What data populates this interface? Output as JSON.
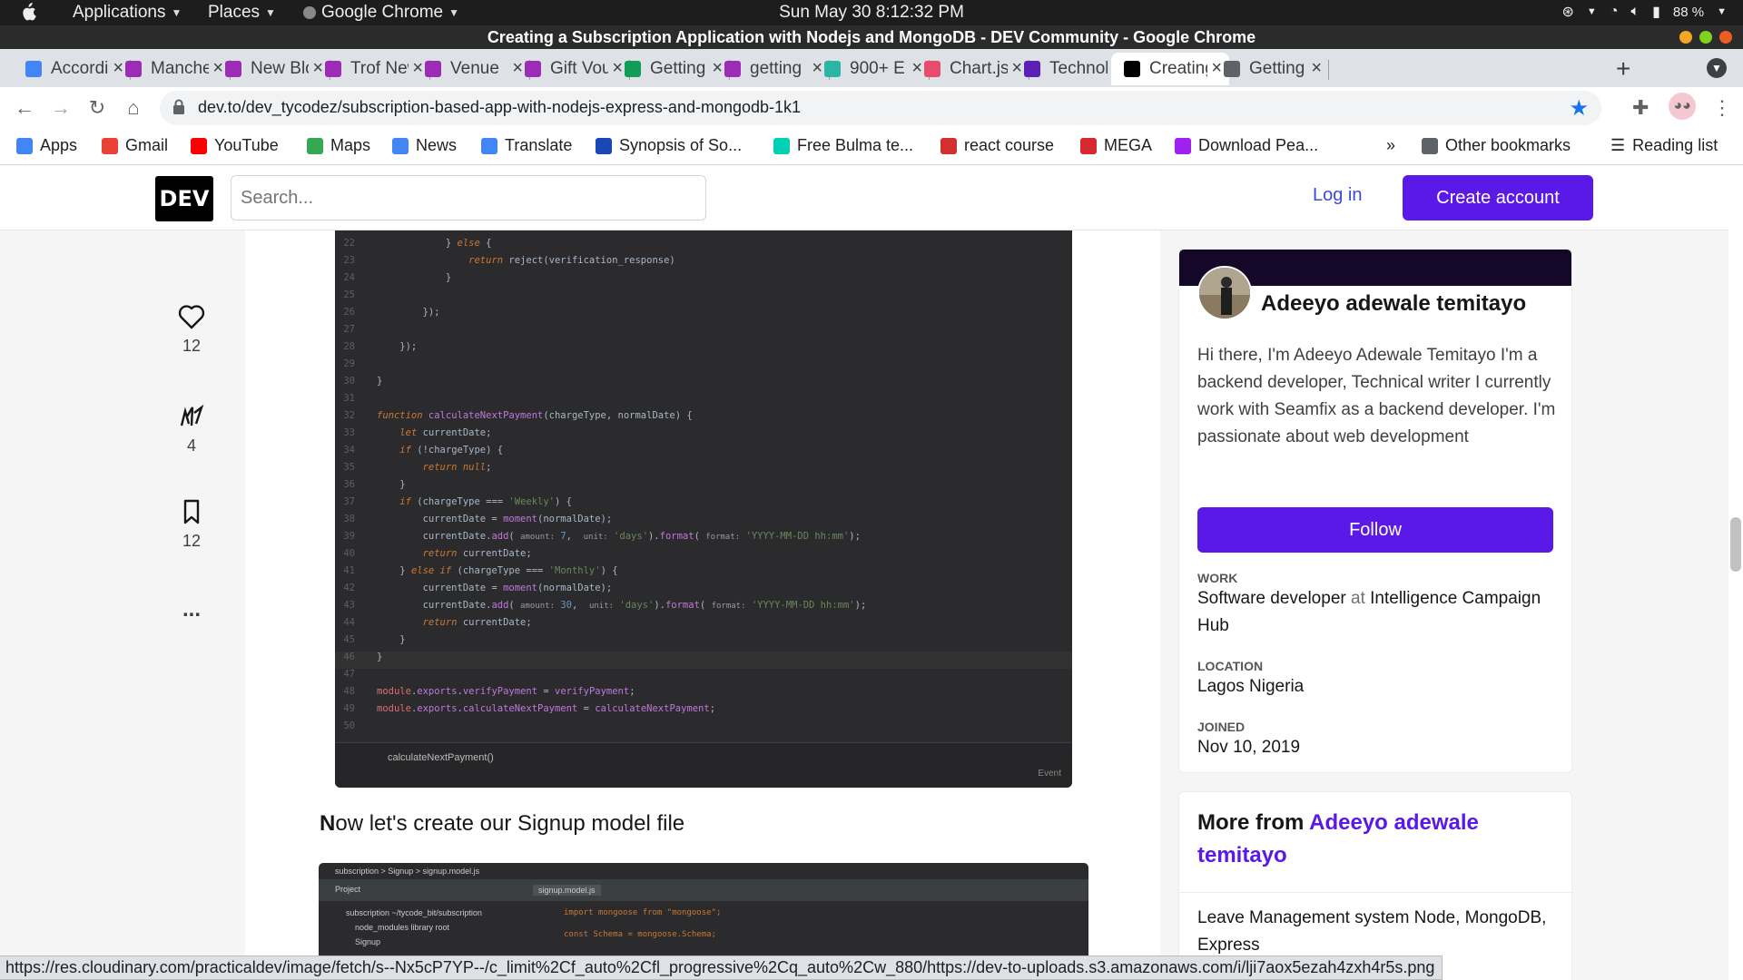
{
  "system_bar": {
    "applications": "Applications",
    "places": "Places",
    "app": "Google Chrome",
    "clock": "Sun May 30   8:12:32 PM",
    "battery": "88 %"
  },
  "window": {
    "title": "Creating a Subscription Application with Nodejs and MongoDB - DEV Community - Google Chrome"
  },
  "tabs": [
    {
      "label": "Accordion",
      "color": "#4285f4",
      "active": false
    },
    {
      "label": "Manchester",
      "color": "#9c2bb5",
      "active": false
    },
    {
      "label": "New Blog",
      "color": "#9c2bb5",
      "active": false
    },
    {
      "label": "Trof News",
      "color": "#9c2bb5",
      "active": false
    },
    {
      "label": "Venue",
      "color": "#9c2bb5",
      "active": false
    },
    {
      "label": "Gift Voucher",
      "color": "#9c2bb5",
      "active": false
    },
    {
      "label": "Getting",
      "color": "#0f9d58",
      "active": false
    },
    {
      "label": "getting",
      "color": "#9c2bb5",
      "active": false
    },
    {
      "label": "900+ E",
      "color": "#2ab5a5",
      "active": false
    },
    {
      "label": "Chart.js",
      "color": "#e74c6c",
      "active": false
    },
    {
      "label": "Technology",
      "color": "#5b21b6",
      "active": false
    },
    {
      "label": "Creating",
      "color": "#000000",
      "active": true
    },
    {
      "label": "Getting",
      "color": "#5f6368",
      "active": false
    }
  ],
  "toolbar": {
    "url": "dev.to/dev_tycodez/subscription-based-app-with-nodejs-express-and-mongodb-1k1"
  },
  "bookmarks": [
    {
      "label": "Apps",
      "color": "#4285f4"
    },
    {
      "label": "Gmail",
      "color": "#ea4335"
    },
    {
      "label": "YouTube",
      "color": "#ff0000"
    },
    {
      "label": "Maps",
      "color": "#34a853"
    },
    {
      "label": "News",
      "color": "#4285f4"
    },
    {
      "label": "Translate",
      "color": "#4285f4"
    },
    {
      "label": "Synopsis of So...",
      "color": "#1a47b8"
    },
    {
      "label": "Free Bulma te...",
      "color": "#00d1b2"
    },
    {
      "label": "react course",
      "color": "#d32f2f"
    },
    {
      "label": "MEGA",
      "color": "#d9272e"
    },
    {
      "label": "Download Pea...",
      "color": "#a020f0"
    }
  ],
  "bookmarks_more": "»",
  "other_bookmarks": "Other bookmarks",
  "reading_list": "Reading list",
  "dev": {
    "logo": "DEV",
    "search_placeholder": "Search...",
    "login": "Log in",
    "create_account": "Create account"
  },
  "reactions": {
    "hearts": "12",
    "unicorns": "4",
    "saves": "12",
    "more": "..."
  },
  "code": {
    "lines": [
      {
        "n": "22",
        "html": "            } <span class='kw'>else</span> {"
      },
      {
        "n": "23",
        "html": "                <span class='kw'>return</span> reject(verification_response)"
      },
      {
        "n": "24",
        "html": "            }"
      },
      {
        "n": "25",
        "html": ""
      },
      {
        "n": "26",
        "html": "        });"
      },
      {
        "n": "27",
        "html": ""
      },
      {
        "n": "28",
        "html": "    });"
      },
      {
        "n": "29",
        "html": ""
      },
      {
        "n": "30",
        "html": "}"
      },
      {
        "n": "31",
        "html": ""
      },
      {
        "n": "32",
        "html": "<span class='kw'>function</span> <span class='fn'>calculateNextPayment</span>(chargeType, normalDate) {"
      },
      {
        "n": "33",
        "html": "    <span class='kw'>let</span> currentDate;"
      },
      {
        "n": "34",
        "html": "    <span class='kw'>if</span> (!chargeType) {"
      },
      {
        "n": "35",
        "html": "        <span class='kw'>return null</span>;"
      },
      {
        "n": "36",
        "html": "    }"
      },
      {
        "n": "37",
        "html": "    <span class='kw'>if</span> (chargeType === <span class='str'>'Weekly'</span>) {"
      },
      {
        "n": "38",
        "html": "        currentDate = <span class='fn'>moment</span>(normalDate);"
      },
      {
        "n": "39",
        "html": "        currentDate.<span class='fn'>add</span>( <span class='prm'>amount:</span> <span class='num'>7</span>,  <span class='prm'>unit:</span> <span class='str'>'days'</span>).<span class='fn'>format</span>( <span class='prm'>format:</span> <span class='str'>'YYYY-MM-DD hh:mm'</span>);"
      },
      {
        "n": "40",
        "html": "        <span class='kw'>return</span> currentDate;"
      },
      {
        "n": "41",
        "html": "    } <span class='kw'>else if</span> (chargeType === <span class='str'>'Monthly'</span>) {"
      },
      {
        "n": "42",
        "html": "        currentDate = <span class='fn'>moment</span>(normalDate);"
      },
      {
        "n": "43",
        "html": "        currentDate.<span class='fn'>add</span>( <span class='prm'>amount:</span> <span class='num'>30</span>,  <span class='prm'>unit:</span> <span class='str'>'days'</span>).<span class='fn'>format</span>( <span class='prm'>format:</span> <span class='str'>'YYYY-MM-DD hh:mm'</span>);"
      },
      {
        "n": "44",
        "html": "        <span class='kw'>return</span> currentDate;"
      },
      {
        "n": "45",
        "html": "    }"
      },
      {
        "n": "46",
        "html": "}"
      },
      {
        "n": "47",
        "html": ""
      },
      {
        "n": "48",
        "html": "<span class='mod'>module</span>.<span class='fn'>exports</span>.<span class='fn'>verifyPayment</span> = <span class='fn'>verifyPayment</span>;"
      },
      {
        "n": "49",
        "html": "<span class='mod'>module</span>.<span class='fn'>exports</span>.<span class='fn'>calculateNextPayment</span> = <span class='fn'>calculateNextPayment</span>;"
      },
      {
        "n": "50",
        "html": ""
      }
    ],
    "footer_label": "calculateNextPayment()",
    "footer_event": "Event"
  },
  "article": {
    "paragraph_first": "N",
    "paragraph_rest": "ow let's create our Signup model file"
  },
  "code2": {
    "breadcrumb": "subscription  >  Signup  >  signup.model.js",
    "project_label": "Project",
    "tree_1": "subscription ~/tycode_bit/subscription",
    "tree_2": "node_modules library root",
    "tree_3": "Signup",
    "file_tab": "signup.model.js",
    "line1": "import mongoose from \"mongoose\";",
    "line3": "const Schema = mongoose.Schema;"
  },
  "profile": {
    "name": "Adeeyo adewale temitayo",
    "bio": "Hi there, I'm Adeeyo Adewale Temitayo I'm a backend developer, Technical writer I currently work with Seamfix as a backend developer. I'm passionate about web development",
    "follow": "Follow",
    "work_label": "WORK",
    "work_role": "Software developer",
    "work_at": "at",
    "work_company": "Intelligence Campaign Hub",
    "location_label": "LOCATION",
    "location": "Lagos Nigeria",
    "joined_label": "JOINED",
    "joined": "Nov 10, 2019"
  },
  "more_from": {
    "prefix": "More from",
    "author": "Adeeyo adewale temitayo",
    "item1": "Leave Management system Node, MongoDB, Express"
  },
  "status_url": "https://res.cloudinary.com/practicaldev/image/fetch/s--Nx5cP7YP--/c_limit%2Cf_auto%2Cfl_progressive%2Cq_auto%2Cw_880/https://dev-to-uploads.s3.amazonaws.com/i/lji7aox5ezah4zxh4r5s.png"
}
